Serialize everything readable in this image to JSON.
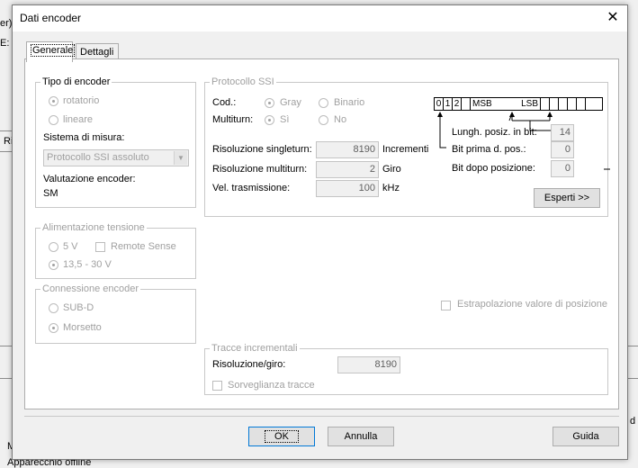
{
  "background": {
    "frag_top": "er)",
    "frag_left": "E:",
    "frag_mid": "Ri",
    "frag_right": "d",
    "frag_m": "M",
    "status_text": "Apparecchio offline"
  },
  "dialog": {
    "title": "Dati encoder",
    "close_glyph": "✕"
  },
  "tabs": [
    {
      "label": "Generale",
      "active": true
    },
    {
      "label": "Dettagli",
      "active": false
    }
  ],
  "encoder_type": {
    "legend": "Tipo di encoder",
    "options": [
      {
        "label": "rotatorio",
        "checked": true
      },
      {
        "label": "lineare",
        "checked": false
      }
    ],
    "measure_label": "Sistema di misura:",
    "measure_value": "Protocollo SSI assoluto",
    "evaluation_label": "Valutazione encoder:",
    "evaluation_value": "SM"
  },
  "power": {
    "legend": "Alimentazione tensione",
    "opt_5v": "5 V",
    "remote_sense": "Remote Sense",
    "opt_range": "13,5 - 30 V"
  },
  "connection": {
    "legend": "Connessione encoder",
    "opt_subd": "SUB-D",
    "opt_terminal": "Morsetto"
  },
  "ssi": {
    "legend": "Protocollo SSI",
    "cod_label": "Cod.:",
    "gray": "Gray",
    "binario": "Binario",
    "multiturn_label": "Multiturn:",
    "si": "Sì",
    "no": "No",
    "res_single_label": "Risoluzione singleturn:",
    "res_single_value": "8190",
    "res_single_unit": "Incrementi",
    "res_multi_label": "Risoluzione multiturn:",
    "res_multi_value": "2",
    "res_multi_unit": "Giro",
    "speed_label": "Vel. trasmissione:",
    "speed_value": "100",
    "speed_unit": "kHz",
    "bits": [
      "0",
      "1",
      "2"
    ],
    "msb": "MSB",
    "lsb": "LSB",
    "len_label": "Lungh. posiz. in bit:",
    "len_value": "14",
    "bit_before_label": "Bit prima d. pos.:",
    "bit_before_value": "0",
    "bit_after_label": "Bit dopo posizione:",
    "bit_after_value": "0",
    "experts_button": "Esperti >>"
  },
  "extrapolation_label": "Estrapolazione valore di posizione",
  "incremental": {
    "legend": "Tracce incrementali",
    "res_label": "Risoluzione/giro:",
    "res_value": "8190",
    "monitor_label": "Sorveglianza tracce"
  },
  "buttons": {
    "ok": "OK",
    "cancel": "Annulla",
    "help": "Guida"
  }
}
